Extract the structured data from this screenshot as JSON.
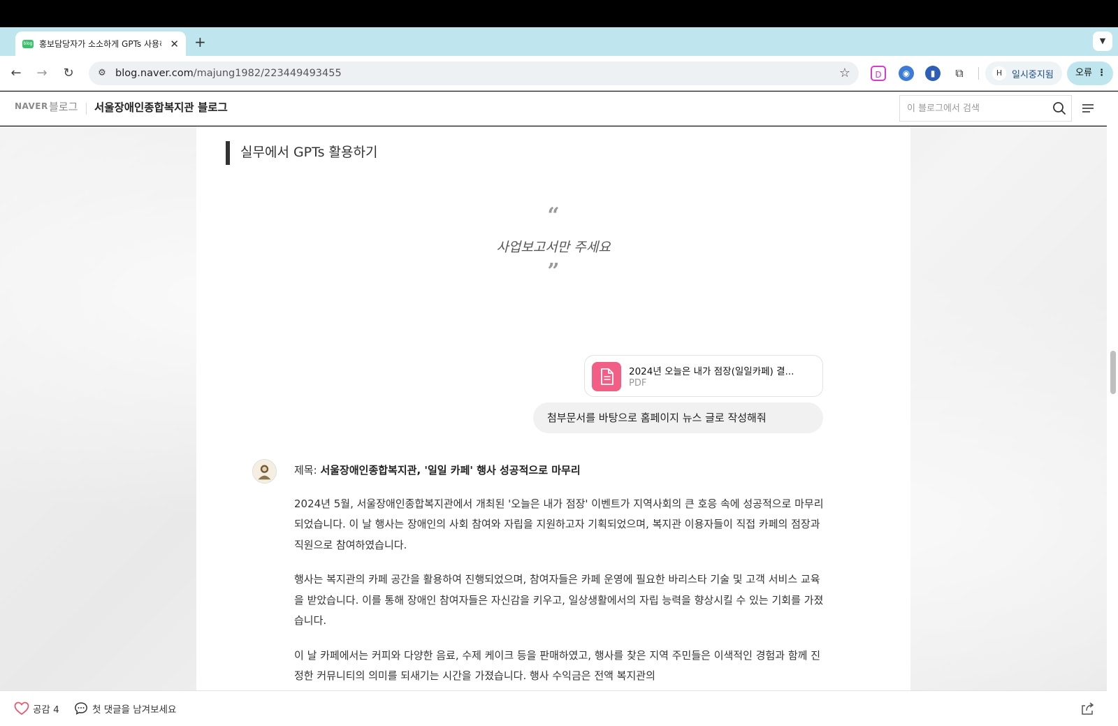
{
  "browser": {
    "tab_title": "홍보담당자가 소소하게 GPTs 사용하기",
    "favicon_text": "blog",
    "new_tab": "+",
    "url_domain": "blog.naver.com",
    "url_path": "/majung1982/223449493455",
    "profile_initial": "H",
    "profile_label": "일시중지됨",
    "error_label": "오류",
    "menu_dots": "⋮"
  },
  "blog": {
    "naver": "NAVER",
    "blog_word": "블로그",
    "title": "서울장애인종합복지관 블로그",
    "search_placeholder": "이 블로그에서 검색"
  },
  "post": {
    "section_title": "실무에서 GPTs 활용하기",
    "quote_open": "“",
    "quote": "사업보고서만 주세요",
    "quote_close": "”",
    "file_name": "2024년 오늘은 내가 점장(일일카페) 결...",
    "file_type": "PDF",
    "user_message": "첨부문서를 바탕으로 홈페이지 뉴스 글로 작성해줘",
    "reply_title_prefix": "제목: ",
    "reply_title": "서울장애인종합복지관, '일일 카페' 행사 성공적으로 마무리",
    "paragraphs": [
      "2024년 5월, 서울장애인종합복지관에서 개최된 '오늘은 내가 점장' 이벤트가 지역사회의 큰 호응 속에 성공적으로 마무리되었습니다. 이 날 행사는 장애인의 사회 참여와 자립을 지원하고자 기획되었으며, 복지관 이용자들이 직접 카페의 점장과 직원으로 참여하였습니다.",
      "행사는 복지관의 카페 공간을 활용하여 진행되었으며, 참여자들은 카페 운영에 필요한 바리스타 기술 및 고객 서비스 교육을 받았습니다. 이를 통해 장애인 참여자들은 자신감을 키우고, 일상생활에서의 자립 능력을 향상시킬 수 있는 기회를 가졌습니다.",
      "이 날 카페에서는 커피와 다양한 음료, 수제 케이크 등을 판매하였고, 행사를 찾은 지역 주민들은 이색적인 경험과 함께 진정한 커뮤니티의 의미를 되새기는 시간을 가졌습니다. 행사 수익금은 전액 복지관의"
    ]
  },
  "footer": {
    "like_label": "공감 4",
    "comment_label": "첫 댓글을 남겨보세요"
  },
  "colors": {
    "tabstrip": "#bfe6ee",
    "pdf_icon": "#f25f86",
    "like_heart": "#e8546b"
  }
}
